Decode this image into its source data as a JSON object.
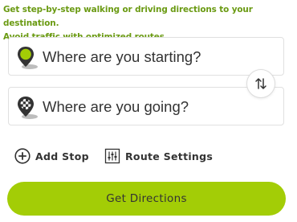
{
  "intro": {
    "line1": "Get step-by-step walking or driving directions to your destination.",
    "line2": "Avoid traffic with optimized routes."
  },
  "start": {
    "placeholder": "Where are you starting?"
  },
  "destination": {
    "placeholder": "Where are you going?"
  },
  "actions": {
    "add_stop": "Add Stop",
    "route_settings": "Route Settings"
  },
  "cta": {
    "label": "Get Directions"
  },
  "colors": {
    "accent_text": "#6a9a12",
    "button": "#a3cd06",
    "start_pin": "#a3cd06",
    "dest_pin": "#333333"
  },
  "icons": {
    "start": "start-pin-icon",
    "destination": "destination-flag-pin-icon",
    "swap": "swap-arrows-icon",
    "add_stop": "plus-circle-icon",
    "route_settings": "sliders-icon"
  }
}
